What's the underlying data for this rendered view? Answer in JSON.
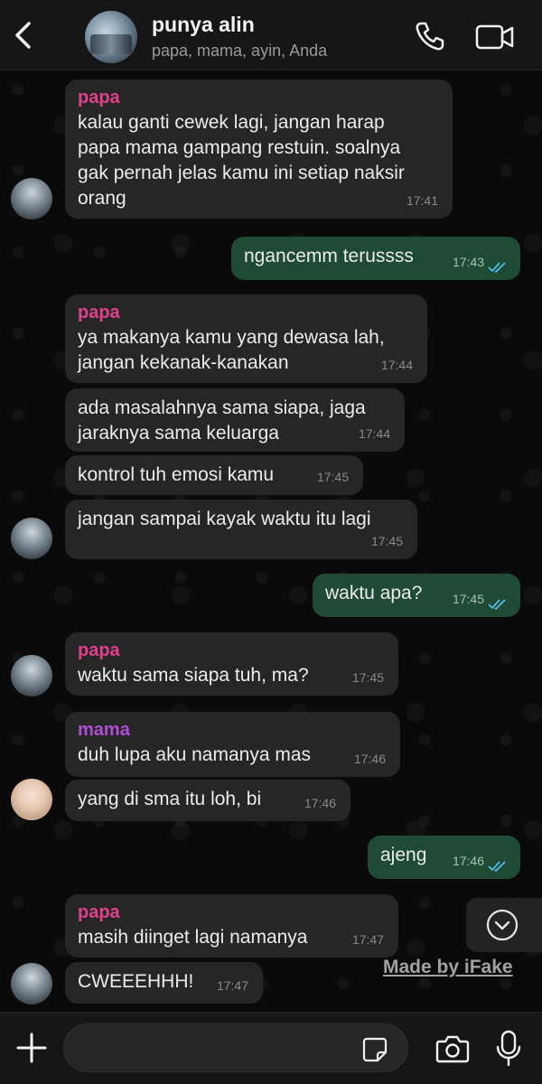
{
  "header": {
    "title": "punya alin",
    "subtitle": "papa, mama, ayin, Anda",
    "icons": [
      "chevron-left-icon",
      "group-avatar",
      "phone-icon",
      "video-camera-icon"
    ]
  },
  "messages": [
    {
      "sender": "papa",
      "text": "kalau ganti cewek lagi, jangan harap\npapa mama gampang restuin. soalnya\ngak pernah jelas kamu ini setiap naksir\norang",
      "time": "17:41",
      "direction": "in"
    },
    {
      "text": "ngancemm terussss",
      "time": "17:43",
      "direction": "out"
    },
    {
      "sender": "papa",
      "text": "ya makanya kamu yang dewasa lah,\njangan kekanak-kanakan",
      "time": "17:44",
      "direction": "in"
    },
    {
      "text": "ada masalahnya sama siapa, jaga\njaraknya sama keluarga",
      "time": "17:44",
      "direction": "in"
    },
    {
      "text": "kontrol tuh emosi kamu",
      "time": "17:45",
      "direction": "in"
    },
    {
      "text": "jangan sampai kayak waktu itu lagi",
      "time": "17:45",
      "direction": "in"
    },
    {
      "text": "waktu apa?",
      "time": "17:45",
      "direction": "out"
    },
    {
      "sender": "papa",
      "text": "waktu sama siapa tuh, ma?",
      "time": "17:45",
      "direction": "in"
    },
    {
      "sender": "mama",
      "text": "duh lupa aku namanya mas",
      "time": "17:46",
      "direction": "in"
    },
    {
      "text": "yang di sma itu loh, bi",
      "time": "17:46",
      "direction": "in"
    },
    {
      "text": "ajeng",
      "time": "17:46",
      "direction": "out"
    },
    {
      "sender": "papa",
      "text": "masih diinget lagi namanya",
      "time": "17:47",
      "direction": "in"
    },
    {
      "text": "CWEEEHHH!",
      "time": "17:47",
      "direction": "in"
    }
  ],
  "watermark": "Made by iFake",
  "composer": {
    "placeholder": "",
    "icons": [
      "plus-icon",
      "sticker-icon",
      "camera-icon",
      "microphone-icon"
    ]
  },
  "colors": {
    "papa": "#e0408c",
    "mama": "#b04fd6",
    "outgoing_bubble": "#1f4a34",
    "incoming_bubble": "#262626",
    "read_ticks": "#53bdeb"
  }
}
